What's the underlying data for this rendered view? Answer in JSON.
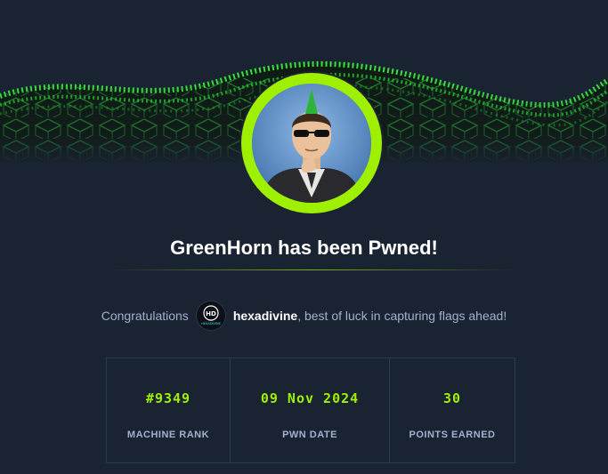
{
  "title": "GreenHorn has been Pwned!",
  "congrats": {
    "prefix": "Congratulations",
    "username": "hexadivine",
    "suffix": ", best of luck in capturing flags ahead!",
    "avatar_text": "HD",
    "avatar_subtext": "HEXADIVINE"
  },
  "stats": [
    {
      "value": "#9349",
      "label": "MACHINE RANK"
    },
    {
      "value": "09 Nov 2024",
      "label": "PWN DATE"
    },
    {
      "value": "30",
      "label": "POINTS EARNED"
    }
  ],
  "colors": {
    "background": "#1a2332",
    "accent": "#9fef00",
    "border": "#2b3a4f",
    "muted_text": "#a4b1cd"
  },
  "icons": {
    "machine_avatar": "greenhorn-machine-avatar",
    "user_avatar": "user-avatar"
  }
}
